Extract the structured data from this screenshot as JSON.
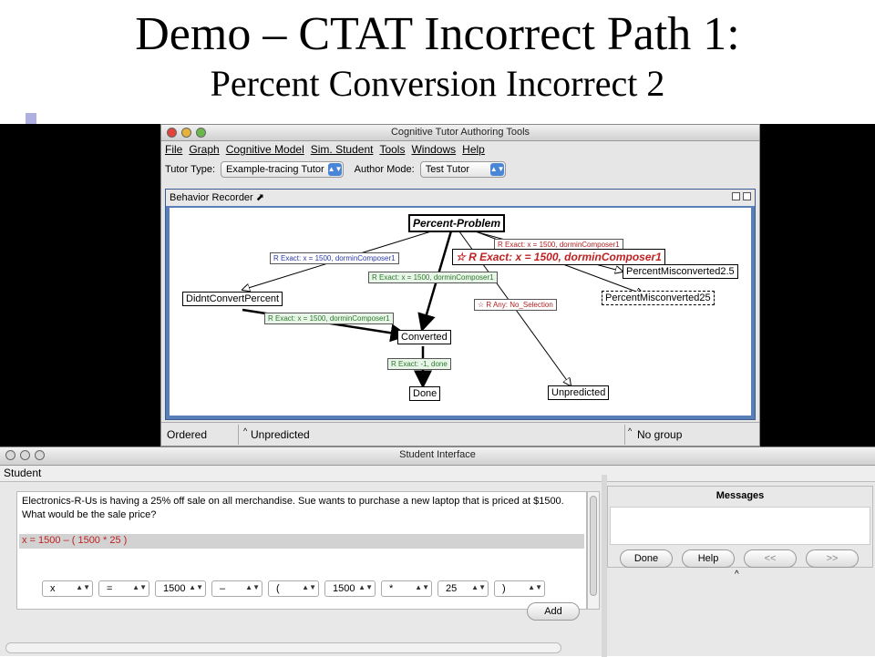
{
  "slide": {
    "title_line1": "Demo – CTAT Incorrect Path 1:",
    "title_line2": "Percent Conversion Incorrect 2"
  },
  "ctat": {
    "window_title": "Cognitive Tutor Authoring Tools",
    "menu": [
      "File",
      "Graph",
      "Cognitive Model",
      "Sim. Student",
      "Tools",
      "Windows",
      "Help"
    ],
    "tutor_type_label": "Tutor Type:",
    "tutor_type_value": "Example-tracing Tutor",
    "author_mode_label": "Author Mode:",
    "author_mode_value": "Test Tutor",
    "panel_title": "Behavior Recorder",
    "graph": {
      "nodes": {
        "root": "Percent-Problem",
        "didnt": "DidntConvertPercent",
        "converted": "Converted",
        "done": "Done",
        "unpredicted": "Unpredicted",
        "misconv25dot": "PercentMisconverted2.5",
        "misconv25": "PercentMisconverted25"
      },
      "labels": {
        "e1": "R Exact: x = 1500, dorminComposer1",
        "e2": "R Exact: x = 1500, dorminComposer1",
        "e3": "R Exact: x = 1500, dorminComposer1",
        "e4": "R Exact: x = 1500, dorminComposer1",
        "e5": "R Exact: x = 1500, dorminComposer1",
        "e6": "R Any: No_Selection",
        "e7": "R Exact: -1, done"
      }
    },
    "status": {
      "left": "Ordered",
      "middle": "Unpredicted",
      "right": "No group"
    }
  },
  "student": {
    "window_title": "Student Interface",
    "section_label": "Student",
    "problem_text": "Electronics-R-Us is having a 25% off sale on all merchandise. Sue wants to purchase a new laptop that is priced at $1500. What would be the sale price?",
    "answer_line": "x = 1500 – ( 1500 * 25 )",
    "selectors": [
      "x",
      "=",
      "1500",
      "–",
      "(",
      "1500",
      "*",
      "25",
      ")"
    ],
    "add_button": "Add",
    "messages_title": "Messages",
    "buttons": {
      "done": "Done",
      "help": "Help",
      "prev": "<<",
      "next": ">>"
    }
  },
  "colors": {
    "graph_frame": "#5a7fb8",
    "incorrect_text": "#c02020",
    "label_blue": "#2a3aa8",
    "label_green": "#2a7a2a"
  }
}
